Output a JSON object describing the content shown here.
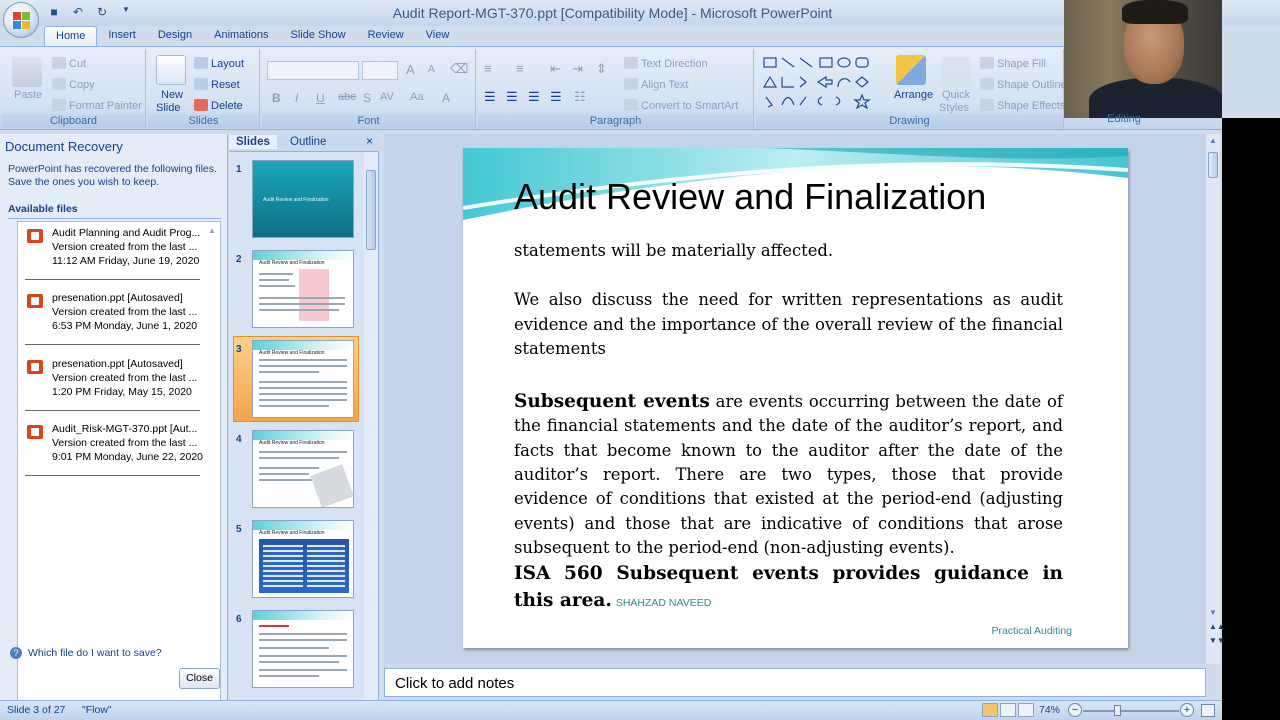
{
  "window": {
    "title": "Audit Report-MGT-370.ppt [Compatibility Mode] - Microsoft PowerPoint"
  },
  "tabs": [
    "Home",
    "Insert",
    "Design",
    "Animations",
    "Slide Show",
    "Review",
    "View"
  ],
  "ribbon": {
    "clipboard": {
      "label": "Clipboard",
      "paste": "Paste",
      "cut": "Cut",
      "copy": "Copy",
      "format_painter": "Format Painter"
    },
    "slides": {
      "label": "Slides",
      "new_slide_1": "New",
      "new_slide_2": "Slide",
      "layout": "Layout",
      "reset": "Reset",
      "delete": "Delete"
    },
    "font": {
      "label": "Font"
    },
    "paragraph": {
      "label": "Paragraph",
      "text_direction": "Text Direction",
      "align_text": "Align Text",
      "convert_smartart": "Convert to SmartArt"
    },
    "drawing": {
      "label": "Drawing",
      "arrange": "Arrange",
      "quick_styles_1": "Quick",
      "quick_styles_2": "Styles",
      "shape_fill": "Shape Fill",
      "shape_outline": "Shape Outline",
      "shape_effects": "Shape Effects"
    },
    "editing": {
      "label": "Editing"
    }
  },
  "recovery": {
    "title": "Document Recovery",
    "description": "PowerPoint has recovered the following files. Save the ones you wish to keep.",
    "available_label": "Available files",
    "files": [
      {
        "name": "Audit Planning and Audit Prog...",
        "version": "Version created from the last ...",
        "date": "11:12 AM Friday, June 19, 2020"
      },
      {
        "name": "presenation.ppt  [Autosaved]",
        "version": "Version created from the last ...",
        "date": "6:53 PM Monday, June 1, 2020"
      },
      {
        "name": "presenation.ppt  [Autosaved]",
        "version": "Version created from the last ...",
        "date": "1:20 PM Friday, May 15, 2020"
      },
      {
        "name": "Audit_Risk-MGT-370.ppt  [Aut...",
        "version": "Version created from the last ...",
        "date": "9:01 PM Monday, June 22, 2020"
      }
    ],
    "help_link": "Which file do I want to save?",
    "close_button": "Close"
  },
  "slides_pane": {
    "tab_slides": "Slides",
    "tab_outline": "Outline",
    "close": "×",
    "thumb_numbers": [
      "1",
      "2",
      "3",
      "4",
      "5",
      "6"
    ],
    "thumb_titles": [
      "Audit Review and Finalization",
      "Audit Review and Finalization",
      "Audit Review and Finalization",
      "Audit Review and Finalization",
      "Audit Review and Finalization",
      ""
    ]
  },
  "slide": {
    "title": "Audit Review and Finalization",
    "para1": "statements will be materially affected.",
    "para2": "We also discuss the need for written representations as audit evidence and the importance of the overall review of the financial statements",
    "para3_bold": "Subsequent events",
    "para3_rest": " are events occurring between the date of the financial statements and the date of the auditor’s report, and facts that become known to the auditor after the date of the auditor’s report. There are two types, those that provide evidence of conditions that existed at the period-end (adjusting events) and those that are indicative of conditions that arose subsequent to the period-end (non-adjusting events).",
    "para4": "ISA 560 Subsequent events provides guidance in this area.",
    "footer_left": "SHAHZAD NAVEED",
    "footer_right": "Practical Auditing"
  },
  "notes": {
    "placeholder": "Click to add notes"
  },
  "status": {
    "slide_info": "Slide 3 of 27",
    "theme": "\"Flow\"",
    "zoom": "74%"
  },
  "colors": {
    "accent": "#15428b",
    "ribbon": "#dbe7f6",
    "selected_thumb": "#f5a44a",
    "footer": "#2f8a8e"
  }
}
